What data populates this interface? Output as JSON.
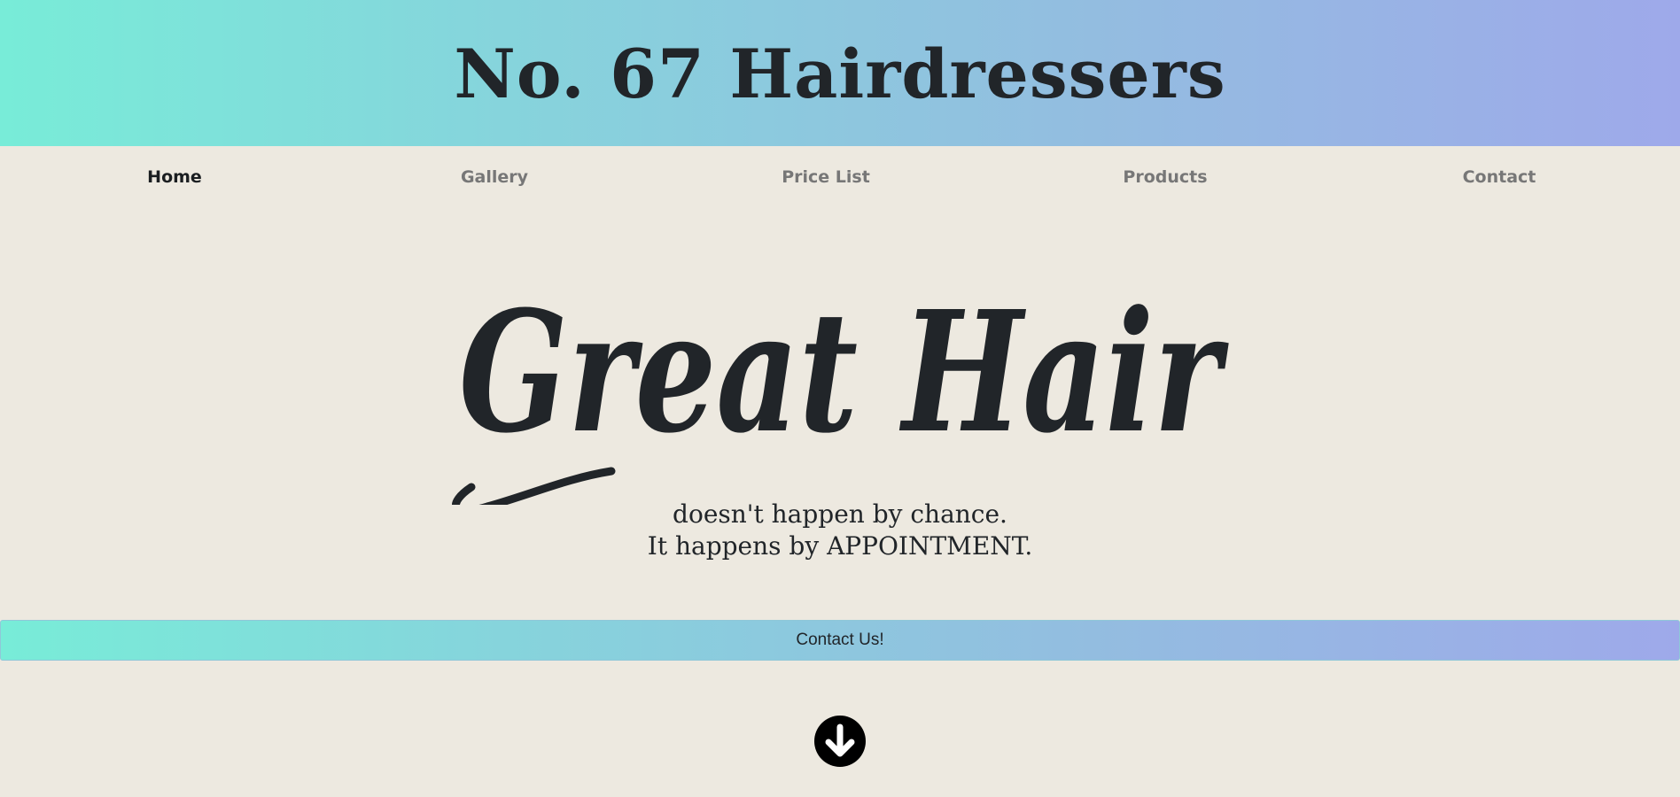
{
  "header": {
    "title": "No. 67 Hairdressers",
    "gradient_colors": [
      "#78ecd8",
      "#86d4dc",
      "#93bde0",
      "#9ea9ea"
    ]
  },
  "nav": {
    "items": [
      {
        "label": "Home",
        "active": true
      },
      {
        "label": "Gallery",
        "active": false
      },
      {
        "label": "Price List",
        "active": false
      },
      {
        "label": "Products",
        "active": false
      },
      {
        "label": "Contact",
        "active": false
      }
    ]
  },
  "hero": {
    "script_text": "Great Hair",
    "line1": "doesn't happen by chance.",
    "line2": "It happens by APPOINTMENT."
  },
  "contact_button": {
    "label": "Contact Us!"
  },
  "scroll_down": {
    "icon": "arrow-down-circle-icon"
  },
  "colors": {
    "background": "#ede9e0",
    "text": "#212529",
    "nav_inactive": "#777777"
  }
}
